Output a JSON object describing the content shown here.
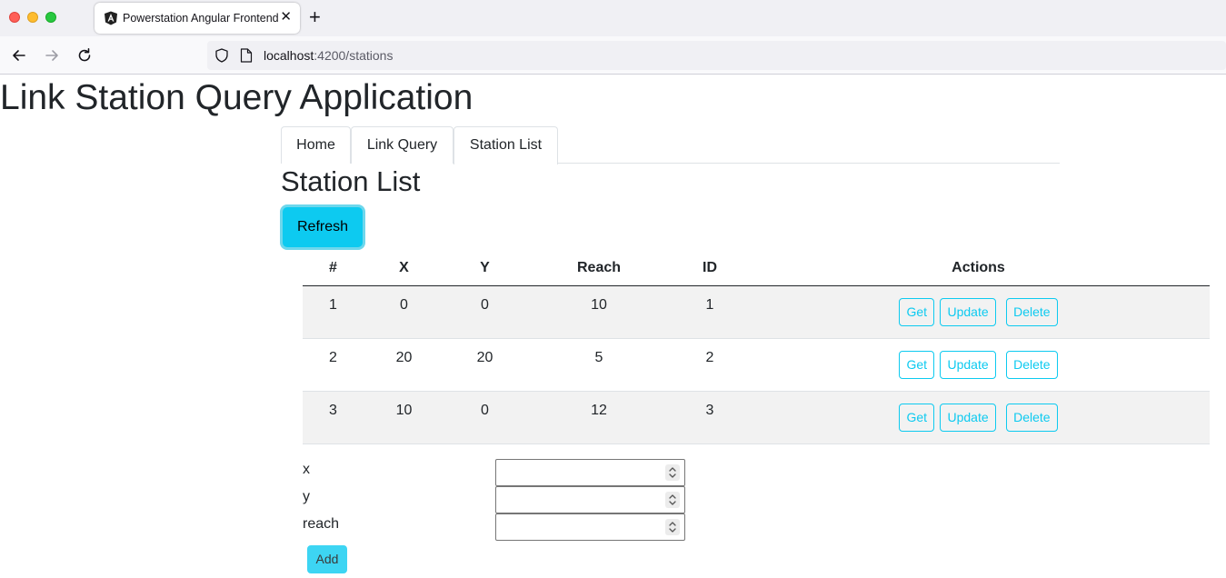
{
  "browser": {
    "tab_title": "Powerstation Angular Frontend",
    "url_host": "localhost",
    "url_path": ":4200/stations"
  },
  "app": {
    "title": "Link Station Query Application"
  },
  "nav_tabs": [
    {
      "label": "Home"
    },
    {
      "label": "Link Query"
    },
    {
      "label": "Station List"
    }
  ],
  "section": {
    "title": "Station List",
    "refresh_label": "Refresh"
  },
  "table": {
    "headers": [
      "#",
      "X",
      "Y",
      "Reach",
      "ID",
      "Actions"
    ],
    "rows": [
      {
        "index": "1",
        "x": "0",
        "y": "0",
        "reach": "10",
        "id": "1"
      },
      {
        "index": "2",
        "x": "20",
        "y": "20",
        "reach": "5",
        "id": "2"
      },
      {
        "index": "3",
        "x": "10",
        "y": "0",
        "reach": "12",
        "id": "3"
      }
    ],
    "action_labels": {
      "get": "Get",
      "update": "Update",
      "delete": "Delete"
    }
  },
  "form": {
    "x_label": "x",
    "y_label": "y",
    "reach_label": "reach",
    "add_label": "Add"
  },
  "colors": {
    "accent": "#0dcaf0",
    "add_button": "#3dd5f3",
    "stripe": "#f2f2f2"
  },
  "icons": [
    "angular-logo-icon",
    "close-icon",
    "plus-icon",
    "back-arrow-icon",
    "forward-arrow-icon",
    "reload-icon",
    "shield-icon",
    "page-icon",
    "spinner-icon"
  ]
}
